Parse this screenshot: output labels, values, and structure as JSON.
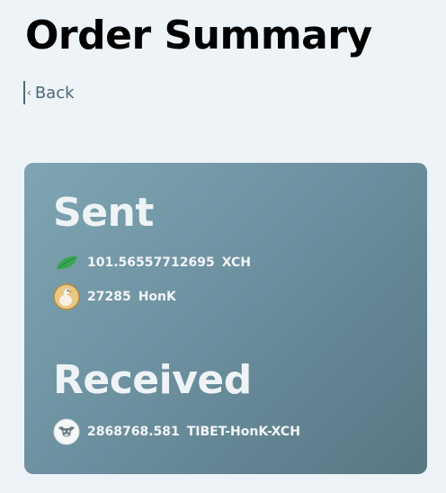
{
  "header": {
    "title": "Order Summary",
    "back_label": "Back",
    "back_chevron": "‹"
  },
  "summary": {
    "sent": {
      "title": "Sent",
      "items": [
        {
          "amount": "101.56557712695",
          "unit": "XCH",
          "icon": "chia-leaf-icon"
        },
        {
          "amount": "27285",
          "unit": "HonK",
          "icon": "honk-goose-icon"
        }
      ]
    },
    "received": {
      "title": "Received",
      "items": [
        {
          "amount": "2868768.581",
          "unit": "TIBET-HonK-XCH",
          "icon": "tibet-lp-icon"
        }
      ]
    }
  },
  "colors": {
    "background": "#eef3f8",
    "card_gradient_start": "#7fa5b3",
    "card_gradient_end": "#587782",
    "back_link": "#4a6878",
    "xch_leaf": "#3aa655"
  }
}
